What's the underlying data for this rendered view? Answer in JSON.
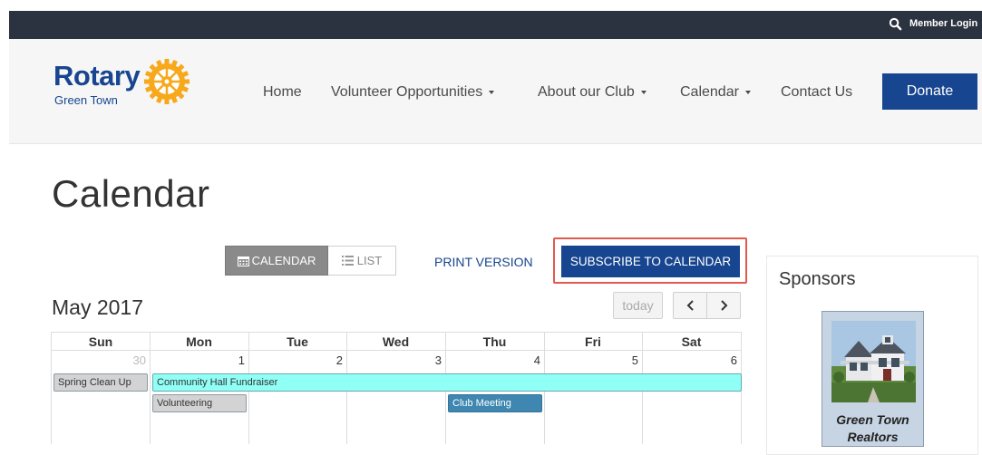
{
  "topbar": {
    "member_login": "Member Login",
    "search_icon": "search-icon"
  },
  "logo": {
    "name": "Rotary",
    "club": "Green Town"
  },
  "nav": {
    "home": "Home",
    "volunteer": "Volunteer Opportunities",
    "about": "About our Club",
    "calendar": "Calendar",
    "contact": "Contact Us",
    "donate": "Donate"
  },
  "page": {
    "title": "Calendar"
  },
  "toolbar": {
    "calendar_view": "CALENDAR",
    "list_view": "LIST",
    "print": "PRINT VERSION",
    "subscribe": "SUBSCRIBE TO CALENDAR"
  },
  "calendar": {
    "month": "May 2017",
    "today_label": "today",
    "days_of_week": [
      "Sun",
      "Mon",
      "Tue",
      "Wed",
      "Thu",
      "Fri",
      "Sat"
    ],
    "dates": [
      "30",
      "1",
      "2",
      "3",
      "4",
      "5",
      "6"
    ],
    "events": {
      "spring_cleanup": "Spring Clean Up",
      "fundraiser": "Community Hall Fundraiser",
      "volunteering": "Volunteering",
      "club_meeting": "Club Meeting"
    }
  },
  "sponsors": {
    "title": "Sponsors",
    "sponsor_name_line1": "Green Town",
    "sponsor_name_line2": "Realtors"
  },
  "colors": {
    "brand_blue": "#17458f",
    "topbar": "#2c3340",
    "highlight": "#e05a4e",
    "event_cyan": "#90fff5",
    "event_blue": "#3f87b0"
  }
}
